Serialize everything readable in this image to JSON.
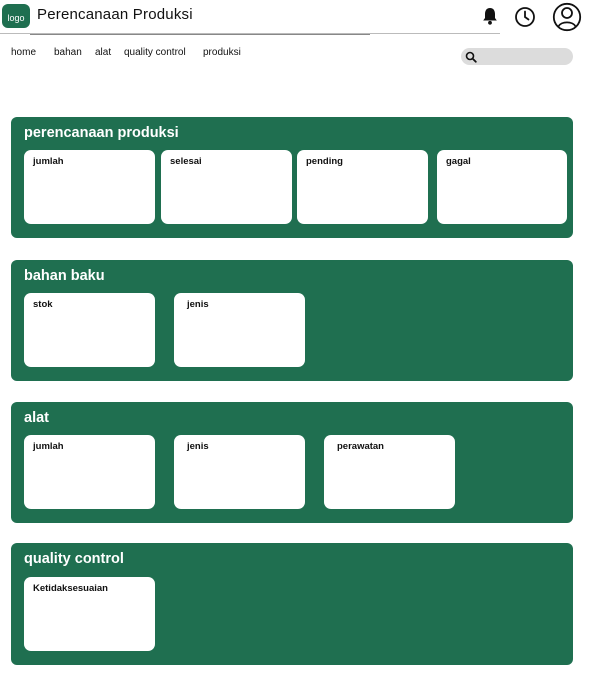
{
  "header": {
    "logo_text": "logo",
    "title": "Perencanaan Produksi",
    "icons": [
      "bell-icon",
      "clock-icon",
      "user-icon"
    ]
  },
  "nav": {
    "items": [
      "home",
      "bahan",
      "alat",
      "quality control",
      "produksi"
    ]
  },
  "search": {
    "placeholder": "",
    "icon": "search-icon"
  },
  "colors": {
    "section_bg": "#1f6f50",
    "card_bg": "#ffffff",
    "search_bg": "#dcdcdc"
  },
  "sections": [
    {
      "title": "perencanaan produksi",
      "cards": [
        "jumlah",
        "selesai",
        "pending",
        "gagal"
      ]
    },
    {
      "title": "bahan baku",
      "cards": [
        "stok",
        "jenis"
      ]
    },
    {
      "title": "alat",
      "cards": [
        "jumlah",
        "jenis",
        "perawatan"
      ]
    },
    {
      "title": "quality control",
      "cards": [
        "Ketidaksesuaian"
      ]
    }
  ]
}
